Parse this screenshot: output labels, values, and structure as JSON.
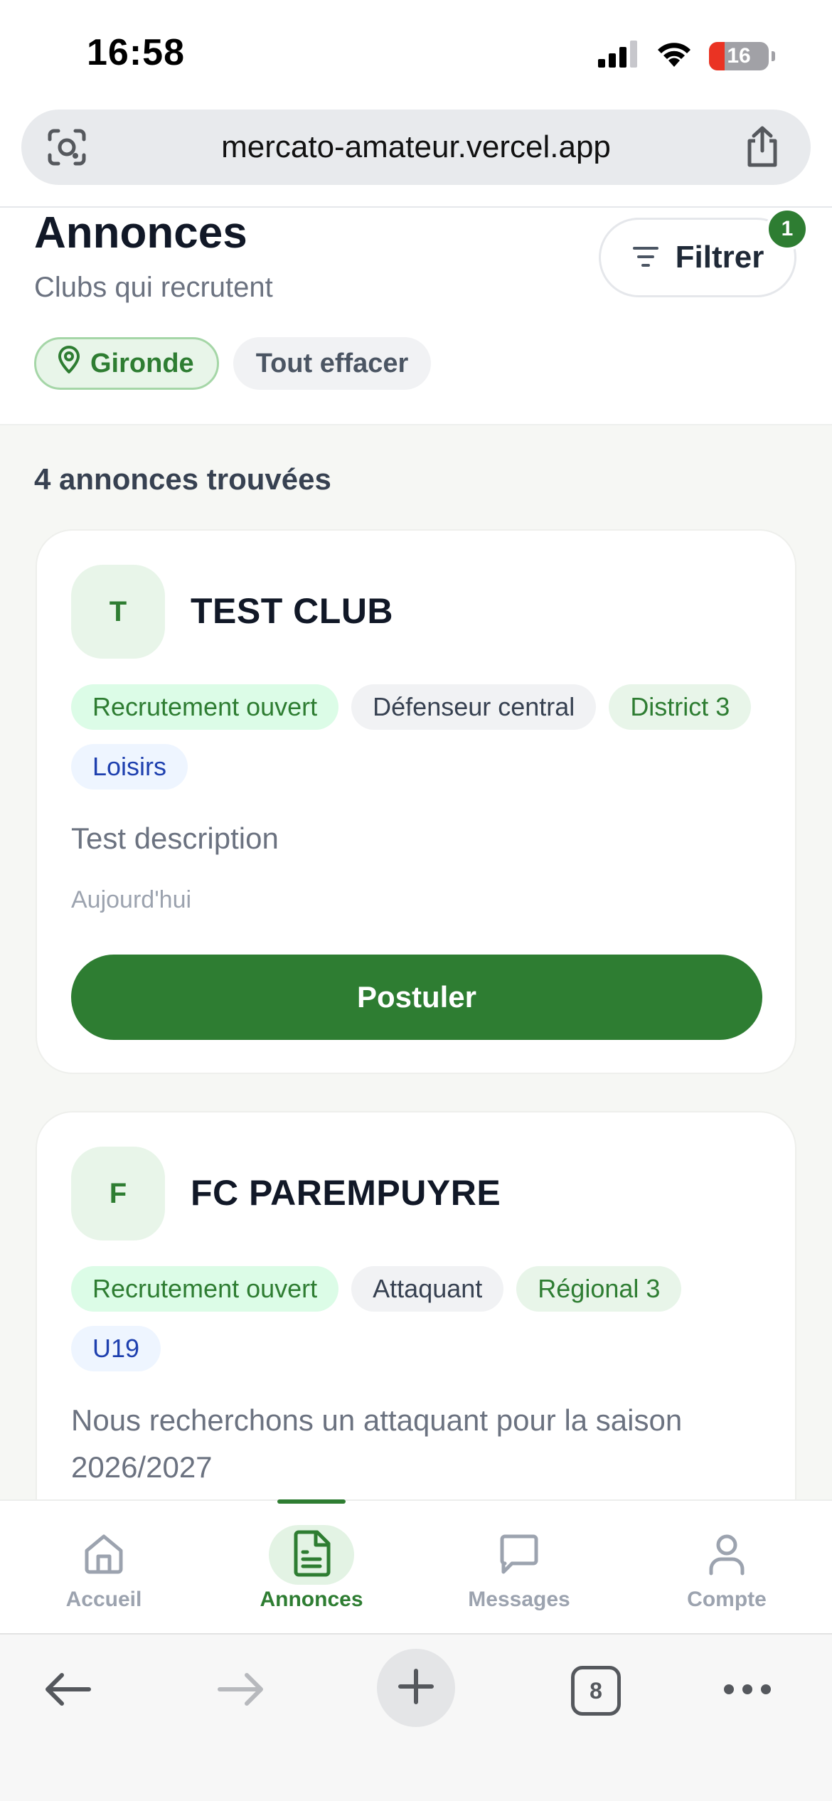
{
  "status_bar": {
    "time": "16:58",
    "battery_level": "16",
    "icons": [
      "signal-icon",
      "wifi-icon",
      "battery-icon"
    ]
  },
  "browser": {
    "url": "mercato-amateur.vercel.app",
    "tabs_count": "8"
  },
  "header": {
    "title": "Annonces",
    "subtitle": "Clubs qui recrutent",
    "filter_label": "Filtrer",
    "filter_badge": "1",
    "active_filters": [
      {
        "label": "Gironde",
        "icon": "location-pin-icon"
      }
    ],
    "clear_label": "Tout effacer"
  },
  "results": {
    "count_label": "4 annonces trouvées"
  },
  "listings": [
    {
      "initial": "T",
      "club": "TEST CLUB",
      "tags": [
        "Recrutement ouvert",
        "Défenseur central",
        "District 3",
        "Loisirs"
      ],
      "description": "Test description",
      "date": "Aujourd'hui",
      "apply_label": "Postuler"
    },
    {
      "initial": "F",
      "club": "FC PAREMPUYRE",
      "tags": [
        "Recrutement ouvert",
        "Attaquant",
        "Régional 3",
        "U19"
      ],
      "description": "Nous recherchons un attaquant pour la saison 2026/2027"
    }
  ],
  "bottom_nav": [
    {
      "label": "Accueil",
      "icon": "home-icon",
      "active": false
    },
    {
      "label": "Annonces",
      "icon": "document-icon",
      "active": true
    },
    {
      "label": "Messages",
      "icon": "chat-bubble-icon",
      "active": false
    },
    {
      "label": "Compte",
      "icon": "user-icon",
      "active": false
    }
  ],
  "colors": {
    "brand_green": "#2e7d32",
    "tag_open_bg": "#dcfce7",
    "tag_category_text": "#1e40af",
    "page_bg": "#f6f7f4"
  }
}
